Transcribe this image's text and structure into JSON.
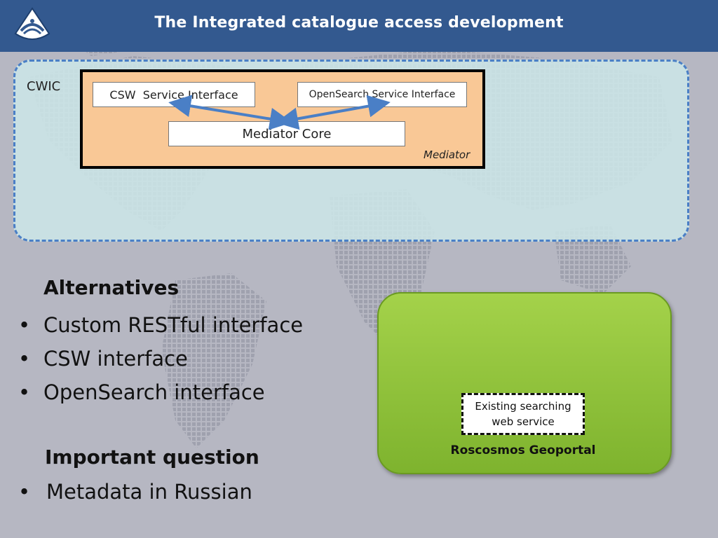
{
  "header": {
    "title": "The Integrated catalogue access development"
  },
  "cwic": {
    "label": "CWIC",
    "mediator": {
      "label": "Mediator",
      "csw_interface": "CSW  Service Interface",
      "opensearch_interface": "OpenSearch Service Interface",
      "core": "Mediator Core"
    }
  },
  "alternatives": {
    "heading": "Alternatives",
    "items": [
      "Custom RESTful interface",
      "CSW interface",
      "OpenSearch interface"
    ]
  },
  "question": {
    "heading": "Important question",
    "items": [
      "Metadata in Russian"
    ]
  },
  "geoportal": {
    "label": "Roscosmos Geoportal",
    "service": "Existing searching web service"
  },
  "colors": {
    "header": "#33598f",
    "cwic_fill": "#cde7e9",
    "cwic_border": "#4a7fc6",
    "mediator_fill": "#f9c896",
    "arrow": "#4a7fc6",
    "geoportal_fill": "#8cc23a"
  }
}
